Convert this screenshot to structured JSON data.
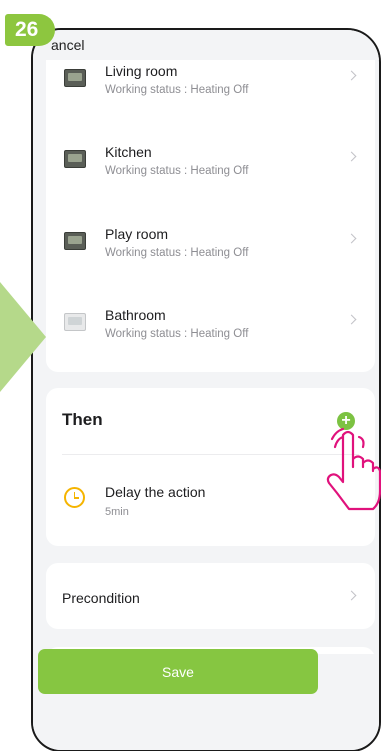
{
  "step_badge": "26",
  "header": {
    "cancel_label": "ancel"
  },
  "devices": [
    {
      "name": "Living room",
      "status": "Working status : Heating Off"
    },
    {
      "name": "Kitchen",
      "status": "Working status : Heating Off"
    },
    {
      "name": "Play room",
      "status": "Working status : Heating Off"
    },
    {
      "name": "Bathroom",
      "status": "Working status : Heating Off"
    }
  ],
  "then_section": {
    "title": "Then",
    "add_symbol": "+",
    "actions": [
      {
        "title": "Delay the action",
        "subtitle": "5min",
        "icon": "clock-icon"
      }
    ]
  },
  "precondition": {
    "label": "Precondition"
  },
  "footer": {
    "save_label": "Save"
  },
  "colors": {
    "accent_green": "#86c641",
    "badge_green": "#8dc63f",
    "arrow_green": "#b5d98a",
    "clock_orange": "#f5b400",
    "hand_pink": "#e0127c"
  }
}
